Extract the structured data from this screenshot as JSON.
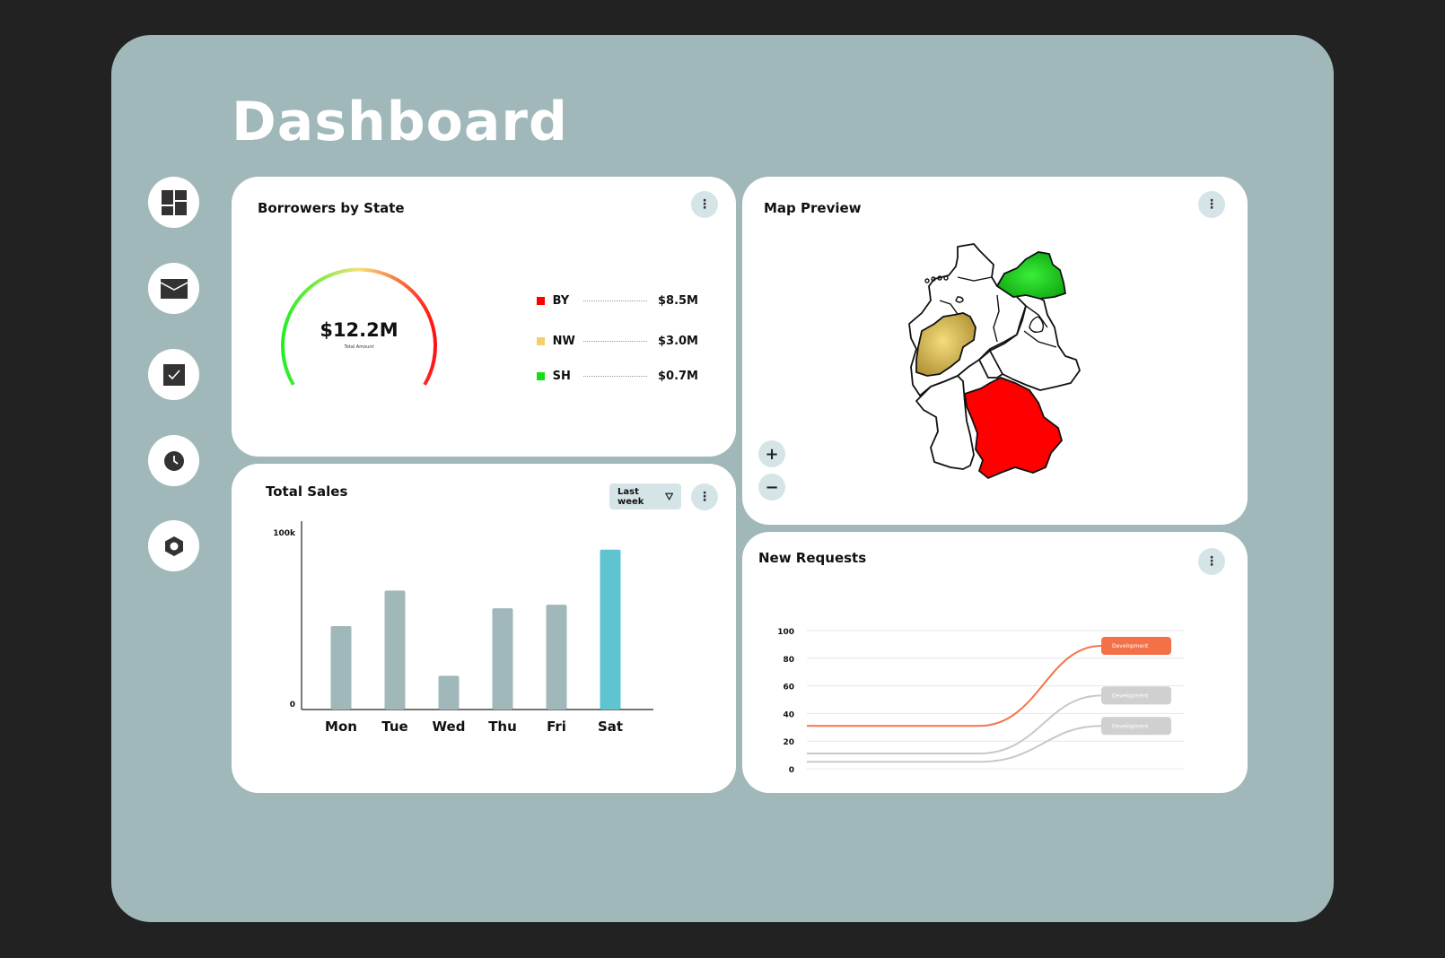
{
  "page": {
    "title": "Dashboard"
  },
  "sidebar": {
    "items": [
      {
        "id": "dashboard",
        "icon": "grid-icon"
      },
      {
        "id": "mail",
        "icon": "mail-icon"
      },
      {
        "id": "tasks",
        "icon": "checkbox-icon"
      },
      {
        "id": "history",
        "icon": "clock-icon"
      },
      {
        "id": "settings",
        "icon": "hex-settings-icon"
      }
    ]
  },
  "borrowers": {
    "title": "Borrowers by State",
    "gauge": {
      "value": "$12.2M",
      "caption": "Total Amount"
    },
    "legend": [
      {
        "code": "BY",
        "value": "$8.5M",
        "color": "#ff0000"
      },
      {
        "code": "NW",
        "value": "$3.0M",
        "color": "#f5d06a"
      },
      {
        "code": "SH",
        "value": "$0.7M",
        "color": "#14dd14"
      }
    ]
  },
  "map": {
    "title": "Map Preview",
    "zoom_in": "+",
    "zoom_out": "−",
    "highlight_colors": {
      "BY": "#ff0000",
      "NW": "#c9a94a",
      "MV": "#14c814"
    }
  },
  "sales": {
    "title": "Total Sales",
    "period": "Last week",
    "chart_data": {
      "type": "bar",
      "categories": [
        "Mon",
        "Tue",
        "Wed",
        "Thu",
        "Fri",
        "Sat"
      ],
      "values": [
        47,
        67,
        19,
        57,
        59,
        90
      ],
      "ylim": [
        0,
        100
      ],
      "yticks": [
        "0",
        "100k"
      ],
      "bar_colors": [
        "#a1b8ba",
        "#a1b8ba",
        "#a1b8ba",
        "#a1b8ba",
        "#a1b8ba",
        "#5fc3d0"
      ],
      "grid": false
    }
  },
  "requests": {
    "title": "New Requests",
    "chart_data": {
      "type": "line",
      "ylim": [
        0,
        100
      ],
      "yticks": [
        "100",
        "80",
        "60",
        "40",
        "20",
        "0"
      ],
      "grid": true,
      "series": [
        {
          "name": "Development",
          "start": 31,
          "end": 89,
          "color": "#f2754a",
          "label_color": "#f47148"
        },
        {
          "name": "Development",
          "start": 11,
          "end": 53,
          "color": "#c8c8c8",
          "label_color": "#d0d0d0"
        },
        {
          "name": "Development",
          "start": 5,
          "end": 31,
          "color": "#c8c8c8",
          "label_color": "#d0d0d0"
        }
      ]
    }
  }
}
